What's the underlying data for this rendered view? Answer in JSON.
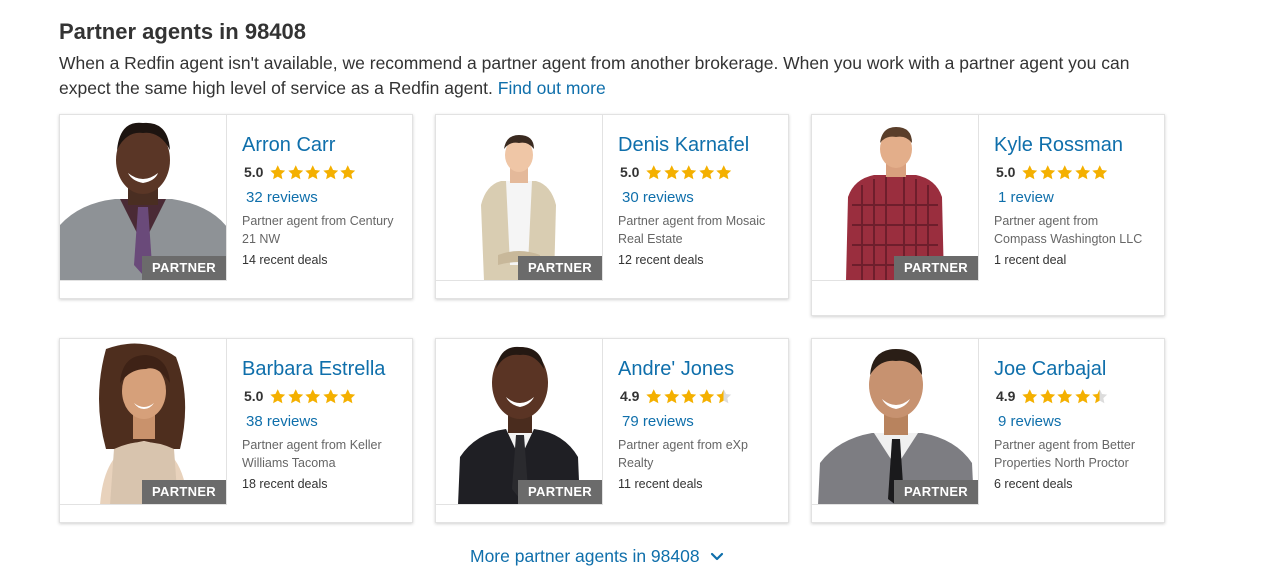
{
  "section": {
    "title": "Partner agents in 98408",
    "description": "When a Redfin agent isn't available, we recommend a partner agent from another brokerage. When you work with a partner agent you can expect the same high level of service as a Redfin agent.",
    "find_out_more": "Find out more"
  },
  "badge_label": "PARTNER",
  "colors": {
    "link": "#0f6fab",
    "star": "#f4b000",
    "badge": "#6b6b6b"
  },
  "agents": [
    {
      "name": "Arron Carr",
      "rating": "5.0",
      "stars": 5,
      "reviews": "32 reviews",
      "brokerage": "Partner agent from Century 21 NW",
      "deals": "14 recent deals"
    },
    {
      "name": "Denis Karnafel",
      "rating": "5.0",
      "stars": 5,
      "reviews": "30 reviews",
      "brokerage": "Partner agent from Mosaic Real Estate",
      "deals": "12 recent deals"
    },
    {
      "name": "Kyle Rossman",
      "rating": "5.0",
      "stars": 5,
      "reviews": "1 review",
      "brokerage": "Partner agent from Compass Washington LLC",
      "deals": "1 recent deal"
    },
    {
      "name": "Barbara Estrella",
      "rating": "5.0",
      "stars": 5,
      "reviews": "38 reviews",
      "brokerage": "Partner agent from Keller Williams Tacoma",
      "deals": "18 recent deals"
    },
    {
      "name": "Andre' Jones",
      "rating": "4.9",
      "stars": 4.5,
      "reviews": "79 reviews",
      "brokerage": "Partner agent from eXp Realty",
      "deals": "11 recent deals"
    },
    {
      "name": "Joe Carbajal",
      "rating": "4.9",
      "stars": 4.5,
      "reviews": "9 reviews",
      "brokerage": "Partner agent from Better Properties North Proctor",
      "deals": "6 recent deals"
    }
  ],
  "more_link": "More partner agents in 98408",
  "icons": {
    "star": "star-icon",
    "chevron": "chevron-down-icon"
  }
}
